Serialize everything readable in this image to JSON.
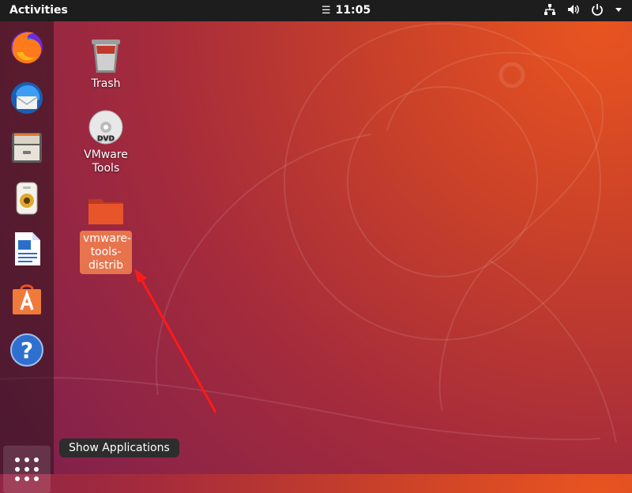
{
  "topbar": {
    "activities": "Activities",
    "clock": "11:05",
    "clock_menu_glyph": "☰",
    "tray_icons": [
      "network-icon",
      "volume-icon",
      "power-icon",
      "chevron-down-icon"
    ]
  },
  "dock": {
    "items": [
      {
        "name": "firefox",
        "icon": "firefox-icon"
      },
      {
        "name": "thunderbird",
        "icon": "thunderbird-icon"
      },
      {
        "name": "files",
        "icon": "files-icon"
      },
      {
        "name": "rhythmbox",
        "icon": "rhythmbox-icon"
      },
      {
        "name": "libreoffice-writer",
        "icon": "writer-icon"
      },
      {
        "name": "ubuntu-software",
        "icon": "software-store-icon"
      },
      {
        "name": "help",
        "icon": "help-icon"
      }
    ],
    "show_apps_tooltip": "Show Applications"
  },
  "desktop": {
    "icons": [
      {
        "label": "Trash",
        "icon": "trash-icon"
      },
      {
        "label_line1": "VMware",
        "label_line2": "Tools",
        "icon": "dvd-icon"
      },
      {
        "label_line1": "vmware-",
        "label_line2": "tools-",
        "label_line3": "distrib",
        "icon": "folder-icon",
        "selected": true
      }
    ]
  },
  "colors": {
    "accent": "#e95420",
    "selection": "#e8744d",
    "topbar": "#1d1d1d",
    "annotation_arrow": "#ff1a1a"
  }
}
